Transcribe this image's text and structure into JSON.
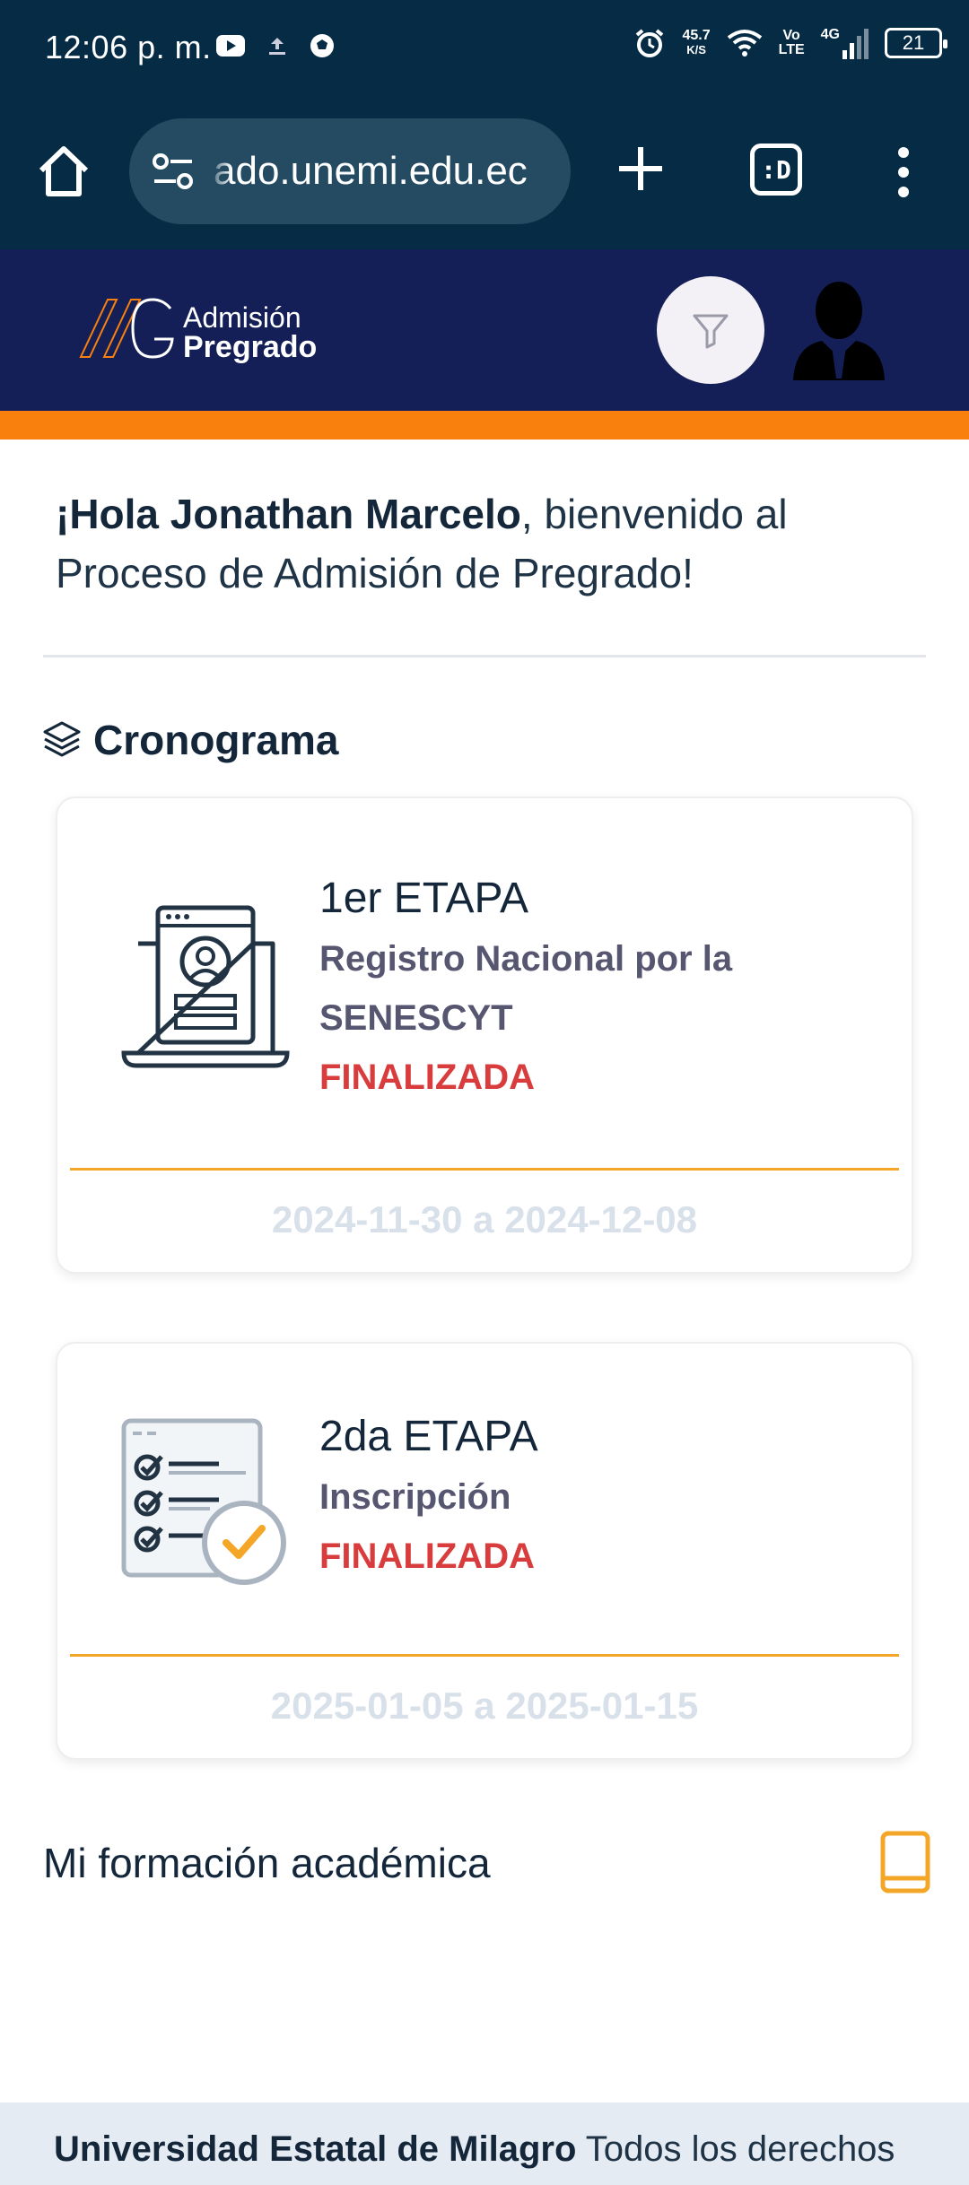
{
  "status_bar": {
    "time": "12:06 p. m.",
    "speed_value": "45.7",
    "speed_unit": "K/S",
    "volte_top": "Vo",
    "volte_bottom": "LTE",
    "network": "4G",
    "battery": "21"
  },
  "browser": {
    "url": "ado.unemi.edu.ec",
    "tabs_label": ":D"
  },
  "header": {
    "logo_line1": "Admisión",
    "logo_line2": "Pregrado",
    "accent_color": "#f9800c",
    "bg_color": "#131f56"
  },
  "greeting": {
    "prefix": "¡",
    "name": "Hola Jonathan Marcelo",
    "rest": ", bienvenido al Proceso de Admisión de Pregrado!"
  },
  "cronograma": {
    "title": "Cronograma",
    "stages": [
      {
        "stage": "1er ETAPA",
        "description": "Registro Nacional por la SENESCYT",
        "status": "FINALIZADA",
        "dates": "2024-11-30 a 2024-12-08",
        "icon": "laptop-profile-icon"
      },
      {
        "stage": "2da ETAPA",
        "description": "Inscripción",
        "status": "FINALIZADA",
        "dates": "2025-01-05 a 2025-01-15",
        "icon": "checklist-icon"
      }
    ]
  },
  "formacion": {
    "label": "Mi formación académica"
  },
  "footer": {
    "bold": "Universidad Estatal de Milagro",
    "rest": " Todos los derechos"
  }
}
